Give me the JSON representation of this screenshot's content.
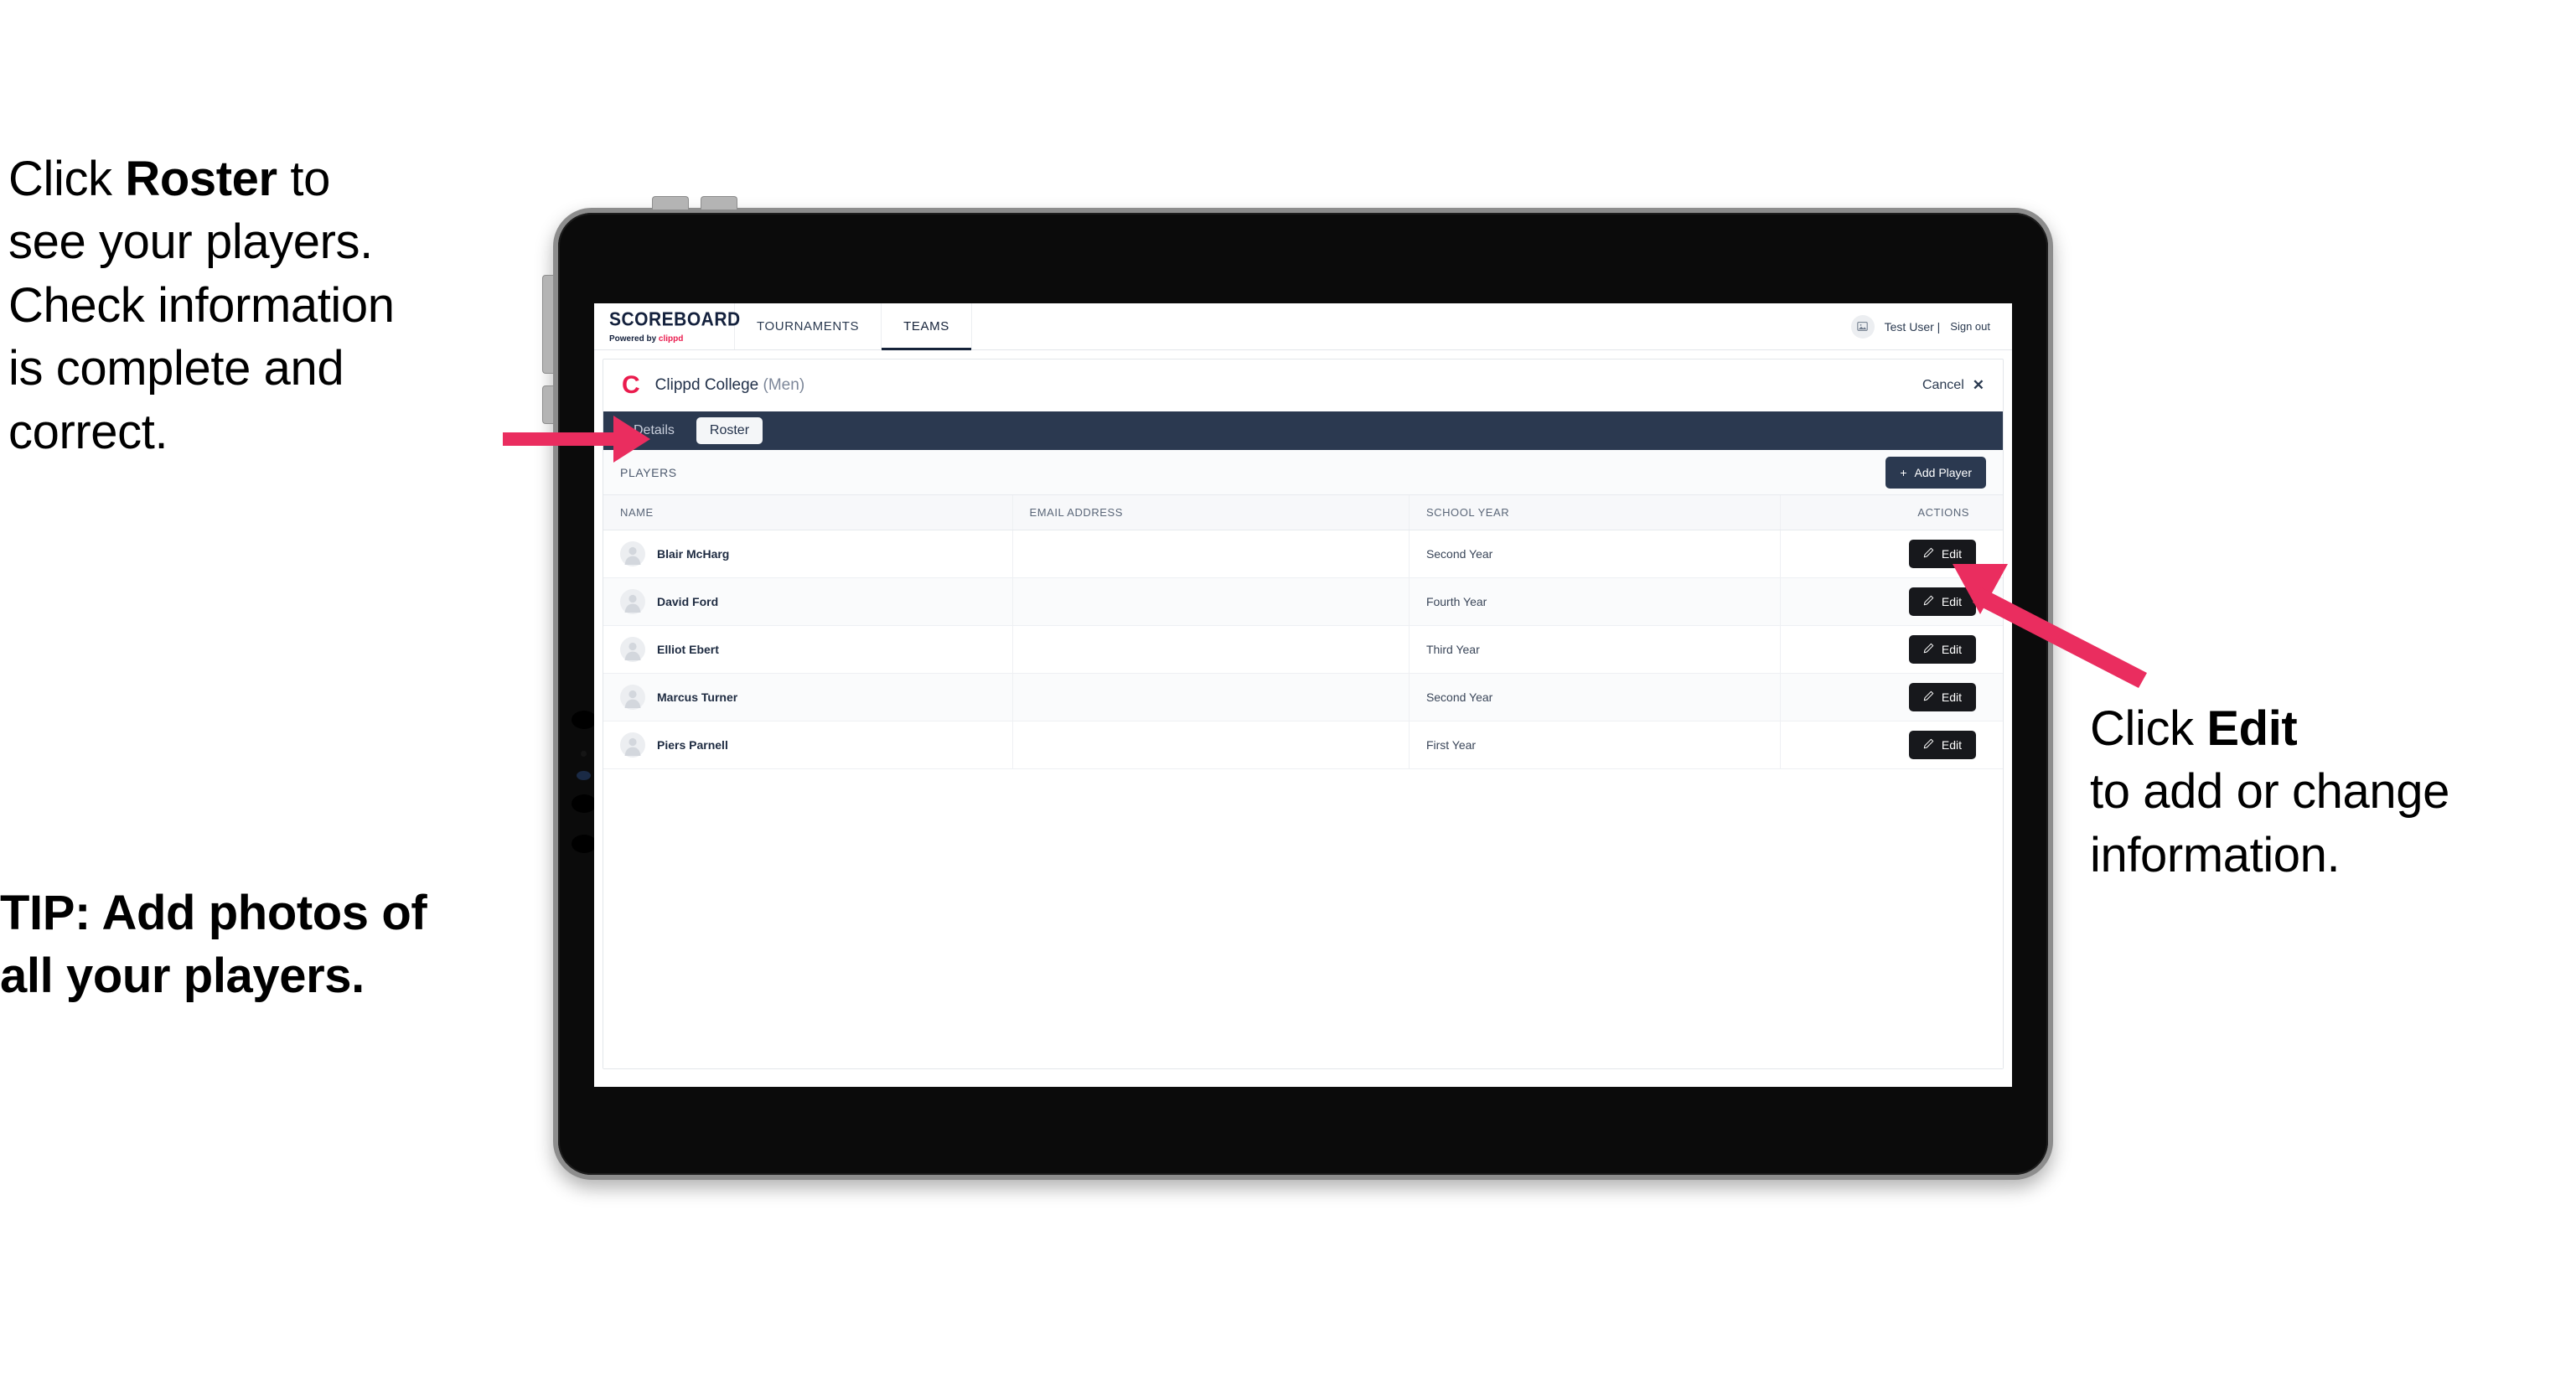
{
  "annotations": {
    "left_top": {
      "line1_pre": "Click ",
      "line1_bold": "Roster",
      "line1_post": " to",
      "line2": "see your players.",
      "line3": "Check information",
      "line4": "is complete and",
      "line5": "correct."
    },
    "left_bottom": {
      "line1": "TIP: Add photos of",
      "line2": "all your players."
    },
    "right": {
      "line1_pre": "Click ",
      "line1_bold": "Edit",
      "line2": "to add or change",
      "line3": "information."
    }
  },
  "colors": {
    "accent_pink": "#ea2d5f",
    "brand_red": "#ea1b4d",
    "navy": "#2b3950",
    "dark_button": "#17181c"
  },
  "app": {
    "topnav": {
      "brand_title": "SCOREBOARD",
      "brand_sub_prefix": "Powered by ",
      "brand_sub_name": "clippd",
      "items": [
        {
          "label": "TOURNAMENTS",
          "active": false
        },
        {
          "label": "TEAMS",
          "active": true
        }
      ],
      "user_name": "Test User |",
      "signout_label": "Sign out",
      "avatar_icon": "user-avatar-icon"
    },
    "card": {
      "team_logo_letter": "C",
      "team_name": "Clippd College",
      "team_name_suffix": "(Men)",
      "cancel_label": "Cancel",
      "close_icon": "close-x-icon",
      "tabs": [
        {
          "label": "Details",
          "active": false
        },
        {
          "label": "Roster",
          "active": true
        }
      ],
      "toolbar": {
        "section_label": "PLAYERS",
        "add_player_label": "Add Player",
        "add_player_icon": "plus-icon"
      },
      "table": {
        "headers": [
          "NAME",
          "EMAIL ADDRESS",
          "SCHOOL YEAR",
          "ACTIONS"
        ],
        "edit_label": "Edit",
        "edit_icon": "pencil-icon",
        "rows": [
          {
            "name": "Blair McHarg",
            "email": "",
            "school_year": "Second Year"
          },
          {
            "name": "David Ford",
            "email": "",
            "school_year": "Fourth Year"
          },
          {
            "name": "Elliot Ebert",
            "email": "",
            "school_year": "Third Year"
          },
          {
            "name": "Marcus Turner",
            "email": "",
            "school_year": "Second Year"
          },
          {
            "name": "Piers Parnell",
            "email": "",
            "school_year": "First Year"
          }
        ]
      }
    }
  }
}
